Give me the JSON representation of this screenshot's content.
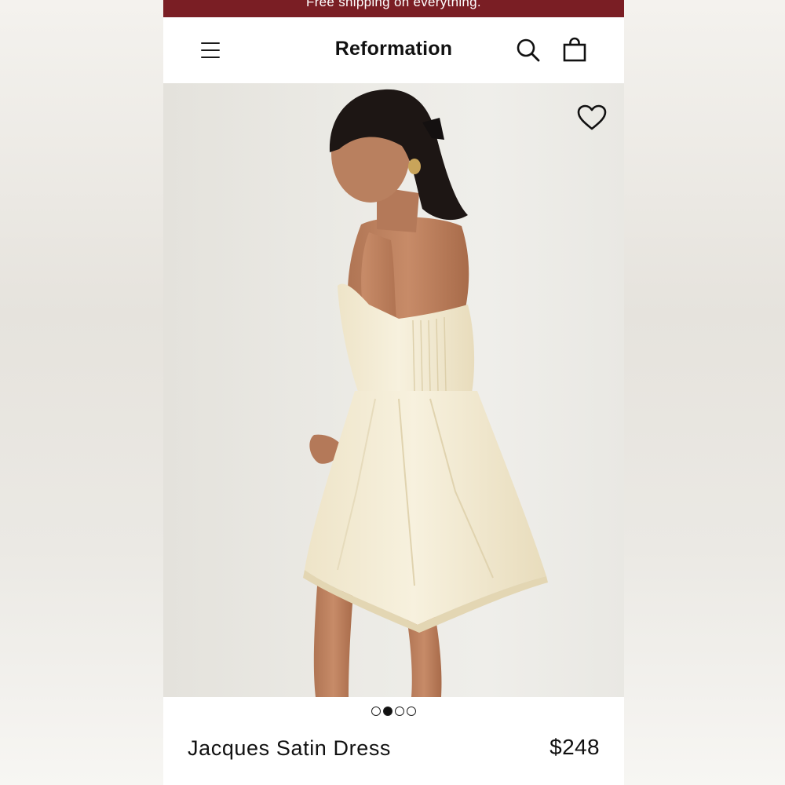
{
  "promo": {
    "text": "Free shipping on everything."
  },
  "header": {
    "brand": "Reformation",
    "menu_icon": "hamburger-menu-icon",
    "search_icon": "search-icon",
    "bag_icon": "shopping-bag-icon"
  },
  "gallery": {
    "favorite_icon": "heart-outline-icon",
    "image_count": 4,
    "active_index": 1
  },
  "product": {
    "name": "Jacques Satin Dress",
    "price": "$248"
  },
  "colors": {
    "promo_bar": "#7a1e24",
    "dress": "#f3ecd6",
    "text": "#111111"
  }
}
